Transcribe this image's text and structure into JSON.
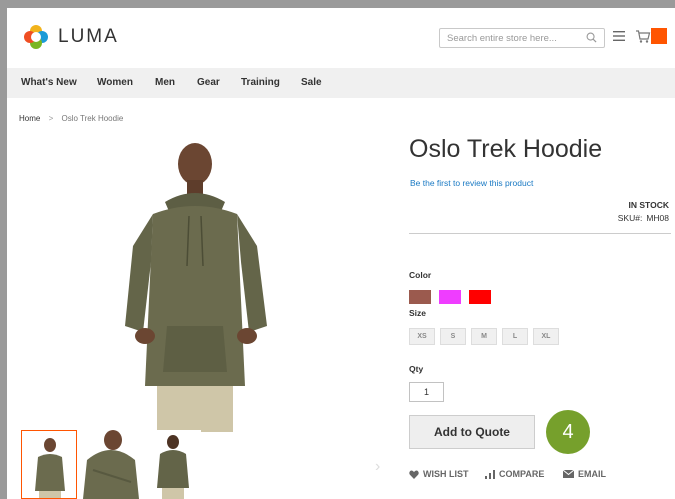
{
  "header": {
    "logo_text": "LUMA",
    "search_placeholder": "Search entire store here..."
  },
  "nav": {
    "items": [
      "What's New",
      "Women",
      "Men",
      "Gear",
      "Training",
      "Sale"
    ]
  },
  "breadcrumb": {
    "home": "Home",
    "separator": ">",
    "current": "Oslo Trek Hoodie"
  },
  "product": {
    "title": "Oslo Trek Hoodie",
    "review_link": "Be the first to review this product",
    "stock": "IN STOCK",
    "sku_label": "SKU#:",
    "sku": "MH08",
    "color_label": "Color",
    "colors": [
      "#9b5a4e",
      "#ef3dff",
      "#ff0000"
    ],
    "size_label": "Size",
    "sizes": [
      "XS",
      "S",
      "M",
      "L",
      "XL"
    ],
    "qty_label": "Qty",
    "qty": "1",
    "add_button": "Add to Quote",
    "step_number": "4",
    "actions": {
      "wishlist": "WISH LIST",
      "compare": "COMPARE",
      "email": "EMAIL"
    }
  },
  "gallery": {
    "next_arrow": "›"
  },
  "colors": {
    "accent": "#ff5501",
    "link": "#1979c3",
    "step_badge": "#76a02c"
  }
}
